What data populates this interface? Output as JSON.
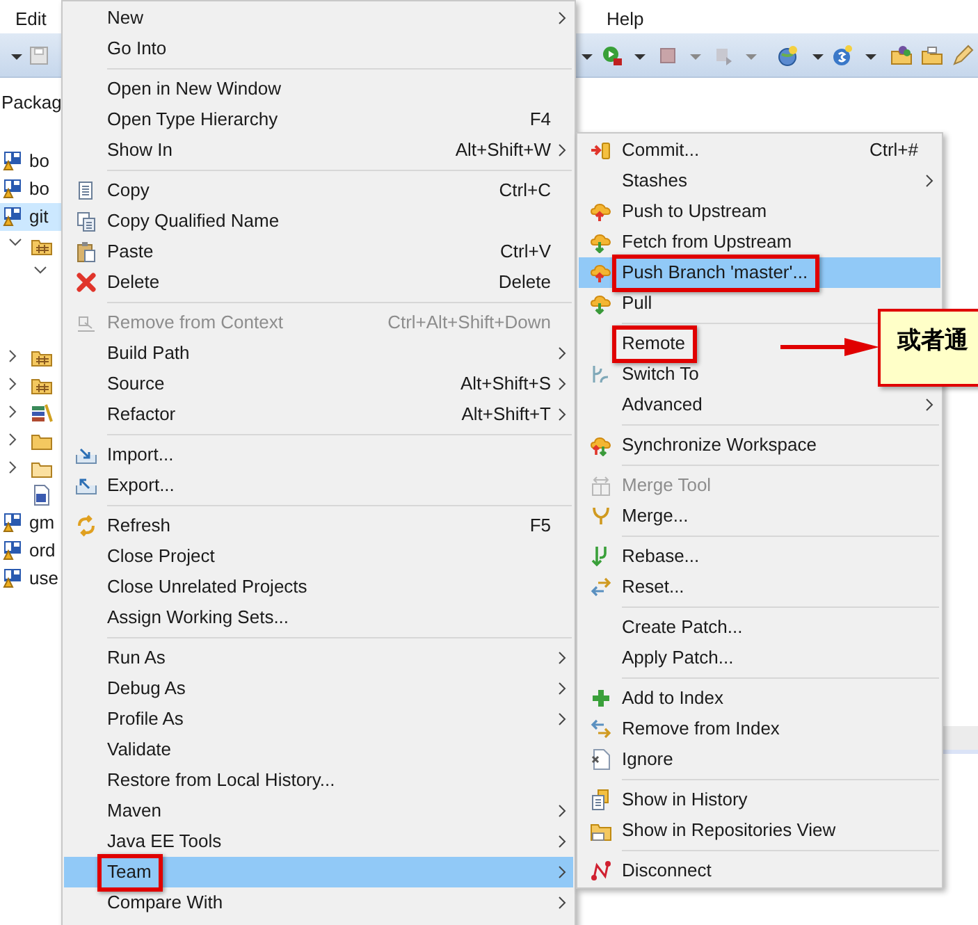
{
  "menu_bar": [
    {
      "label": "Edit"
    },
    {
      "label": "Help"
    }
  ],
  "package_explorer": {
    "tab": "Packag",
    "projects": [
      {
        "label": "bo",
        "selected": false
      },
      {
        "label": "bo",
        "selected": false
      },
      {
        "label": "git",
        "selected": true,
        "children": [
          {
            "kind": "package",
            "expanded": true,
            "children": [
              {
                "expanded": true
              }
            ]
          },
          {
            "kind": "package",
            "expanded": false
          },
          {
            "kind": "package",
            "expanded": false
          },
          {
            "kind": "library",
            "expanded": false
          },
          {
            "kind": "folder",
            "expanded": false
          },
          {
            "kind": "folder",
            "expanded": false
          },
          {
            "kind": "file"
          }
        ]
      },
      {
        "label": "gm",
        "selected": false
      },
      {
        "label": "ord",
        "selected": false
      },
      {
        "label": "use",
        "selected": false
      }
    ]
  },
  "context_menu": {
    "items": [
      {
        "kind": "item",
        "label": "New",
        "submenu": true,
        "selected": false
      },
      {
        "kind": "item",
        "label": "Go Into",
        "selected": false
      },
      {
        "kind": "separator"
      },
      {
        "kind": "item",
        "label": "Open in New Window",
        "selected": false
      },
      {
        "kind": "item",
        "label": "Open Type Hierarchy",
        "shortcut": "F4",
        "selected": false
      },
      {
        "kind": "item",
        "label": "Show In",
        "shortcut": "Alt+Shift+W",
        "submenu": true,
        "selected": false
      },
      {
        "kind": "separator"
      },
      {
        "kind": "item",
        "label": "Copy",
        "shortcut": "Ctrl+C",
        "selected": false
      },
      {
        "kind": "item",
        "label": "Copy Qualified Name",
        "selected": false
      },
      {
        "kind": "item",
        "label": "Paste",
        "shortcut": "Ctrl+V",
        "selected": false
      },
      {
        "kind": "item",
        "label": "Delete",
        "shortcut": "Delete",
        "selected": false
      },
      {
        "kind": "separator"
      },
      {
        "kind": "item",
        "label": "Remove from Context",
        "shortcut": "Ctrl+Alt+Shift+Down",
        "disabled": true,
        "selected": false
      },
      {
        "kind": "item",
        "label": "Build Path",
        "submenu": true,
        "selected": false
      },
      {
        "kind": "item",
        "label": "Source",
        "shortcut": "Alt+Shift+S",
        "submenu": true,
        "selected": false
      },
      {
        "kind": "item",
        "label": "Refactor",
        "shortcut": "Alt+Shift+T",
        "submenu": true,
        "selected": false
      },
      {
        "kind": "separator"
      },
      {
        "kind": "item",
        "label": "Import...",
        "selected": false
      },
      {
        "kind": "item",
        "label": "Export...",
        "selected": false
      },
      {
        "kind": "separator"
      },
      {
        "kind": "item",
        "label": "Refresh",
        "shortcut": "F5",
        "selected": false
      },
      {
        "kind": "item",
        "label": "Close Project",
        "selected": false
      },
      {
        "kind": "item",
        "label": "Close Unrelated Projects",
        "selected": false
      },
      {
        "kind": "item",
        "label": "Assign Working Sets...",
        "selected": false
      },
      {
        "kind": "separator"
      },
      {
        "kind": "item",
        "label": "Run As",
        "submenu": true,
        "selected": false
      },
      {
        "kind": "item",
        "label": "Debug As",
        "submenu": true,
        "selected": false
      },
      {
        "kind": "item",
        "label": "Profile As",
        "submenu": true,
        "selected": false
      },
      {
        "kind": "item",
        "label": "Validate",
        "selected": false
      },
      {
        "kind": "item",
        "label": "Restore from Local History...",
        "selected": false
      },
      {
        "kind": "item",
        "label": "Maven",
        "submenu": true,
        "selected": false
      },
      {
        "kind": "item",
        "label": "Java EE Tools",
        "submenu": true,
        "selected": false
      },
      {
        "kind": "item",
        "label": "Team",
        "submenu": true,
        "selected": true,
        "annotated": true
      },
      {
        "kind": "item",
        "label": "Compare With",
        "submenu": true,
        "selected": false
      }
    ]
  },
  "team_submenu": {
    "items": [
      {
        "kind": "item",
        "label": "Commit...",
        "shortcut": "Ctrl+#",
        "selected": false
      },
      {
        "kind": "item",
        "label": "Stashes",
        "submenu": true,
        "selected": false
      },
      {
        "kind": "item",
        "label": "Push to Upstream",
        "selected": false
      },
      {
        "kind": "item",
        "label": "Fetch from Upstream",
        "selected": false
      },
      {
        "kind": "item",
        "label": "Push Branch 'master'...",
        "selected": true,
        "annotated": true
      },
      {
        "kind": "item",
        "label": "Pull",
        "selected": false
      },
      {
        "kind": "separator"
      },
      {
        "kind": "item",
        "label": "Remote",
        "annotated": true,
        "selected": false
      },
      {
        "kind": "item",
        "label": "Switch To",
        "selected": false
      },
      {
        "kind": "item",
        "label": "Advanced",
        "submenu": true,
        "selected": false
      },
      {
        "kind": "separator"
      },
      {
        "kind": "item",
        "label": "Synchronize Workspace",
        "selected": false
      },
      {
        "kind": "separator"
      },
      {
        "kind": "item",
        "label": "Merge Tool",
        "disabled": true,
        "selected": false
      },
      {
        "kind": "item",
        "label": "Merge...",
        "selected": false
      },
      {
        "kind": "separator"
      },
      {
        "kind": "item",
        "label": "Rebase...",
        "selected": false
      },
      {
        "kind": "item",
        "label": "Reset...",
        "selected": false
      },
      {
        "kind": "separator"
      },
      {
        "kind": "item",
        "label": "Create Patch...",
        "selected": false
      },
      {
        "kind": "item",
        "label": "Apply Patch...",
        "selected": false
      },
      {
        "kind": "separator"
      },
      {
        "kind": "item",
        "label": "Add to Index",
        "selected": false
      },
      {
        "kind": "item",
        "label": "Remove from Index",
        "selected": false
      },
      {
        "kind": "item",
        "label": "Ignore",
        "selected": false
      },
      {
        "kind": "separator"
      },
      {
        "kind": "item",
        "label": "Show in History",
        "selected": false
      },
      {
        "kind": "item",
        "label": "Show in Repositories View",
        "selected": false
      },
      {
        "kind": "separator"
      },
      {
        "kind": "item",
        "label": "Disconnect",
        "selected": false
      }
    ]
  },
  "callout": {
    "text": "或者通"
  }
}
